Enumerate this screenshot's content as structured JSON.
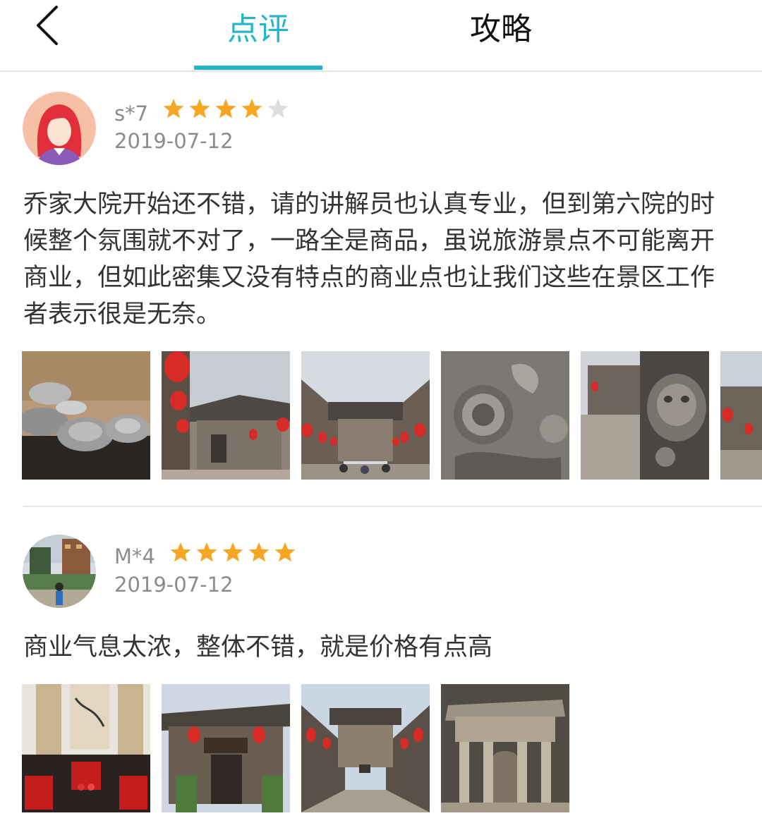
{
  "header": {
    "tabs": [
      {
        "label": "点评",
        "active": true
      },
      {
        "label": "攻略",
        "active": false
      }
    ],
    "accent_color": "#22b6c8"
  },
  "reviews": [
    {
      "username": "s*7",
      "rating": 4,
      "max_rating": 5,
      "date": "2019-07-12",
      "text": "乔家大院开始还不错，请的讲解员也认真专业，但到第六院的时候整个氛围就不对了，一路全是商品，虽说旅游景点不可能离开商业，但如此密集又没有特点的商业点也让我们这些在景区工作者表示很是无奈。",
      "avatar": "female-avatar-icon",
      "photos": [
        "silver-ingots",
        "courtyard-red-lanterns",
        "lantern-alley",
        "carved-flower-relief",
        "carved-lion-relief",
        "courtyard-partial"
      ]
    },
    {
      "username": "M*4",
      "rating": 5,
      "max_rating": 5,
      "date": "2019-07-12",
      "text": "商业气息太浓，整体不错，就是价格有点高",
      "avatar": "photo-avatar",
      "photos": [
        "calligraphy-hall",
        "ornate-gate",
        "courtyard-lanterns",
        "stone-gate"
      ]
    }
  ],
  "colors": {
    "star_on": "#f6a623",
    "star_off": "#dddddd",
    "meta_text": "#8c8c8c"
  }
}
